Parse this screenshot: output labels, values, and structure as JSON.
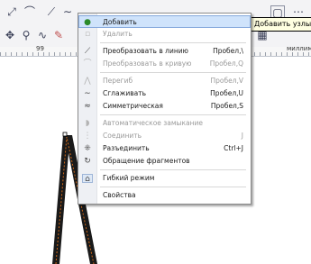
{
  "tooltip": {
    "text": "Добавить узлы"
  },
  "ruler": {
    "labels": [
      "99",
      "миллим"
    ]
  },
  "menu": {
    "items": [
      {
        "label": "Добавить",
        "shortcut": "",
        "icon": "add-node-icon",
        "disabled": false,
        "hover": true
      },
      {
        "label": "Удалить",
        "shortcut": "",
        "icon": "delete-node-icon",
        "disabled": true
      },
      {
        "label": "Преобразовать в линию",
        "shortcut": "Пробел,\\",
        "icon": "to-line-icon",
        "disabled": false
      },
      {
        "label": "Преобразовать в кривую",
        "shortcut": "Пробел,Q",
        "icon": "to-curve-icon",
        "disabled": true
      },
      {
        "label": "Перегиб",
        "shortcut": "Пробел,V",
        "icon": "cusp-icon",
        "disabled": true
      },
      {
        "label": "Сглаживать",
        "shortcut": "Пробел,U",
        "icon": "smooth-icon",
        "disabled": false
      },
      {
        "label": "Симметрическая",
        "shortcut": "Пробел,S",
        "icon": "symmetric-icon",
        "disabled": false
      },
      {
        "label": "Автоматическое замыкание",
        "shortcut": "",
        "icon": "auto-close-icon",
        "disabled": true
      },
      {
        "label": "Соединить",
        "shortcut": "J",
        "icon": "join-icon",
        "disabled": true
      },
      {
        "label": "Разъединить",
        "shortcut": "Ctrl+J",
        "icon": "break-icon",
        "disabled": false
      },
      {
        "label": "Обращение фрагментов",
        "shortcut": "",
        "icon": "reverse-icon",
        "disabled": false
      },
      {
        "label": "Гибкий режим",
        "shortcut": "",
        "icon": "elastic-mode-icon",
        "disabled": false,
        "checked": true
      },
      {
        "label": "Свойства",
        "shortcut": "",
        "icon": "",
        "disabled": false
      }
    ]
  },
  "colors": {
    "menu_hover": "#cfe3fb",
    "tooltip_bg": "#ffffe1",
    "shape": "#1a1a1a",
    "dash": "#d06a1a"
  }
}
